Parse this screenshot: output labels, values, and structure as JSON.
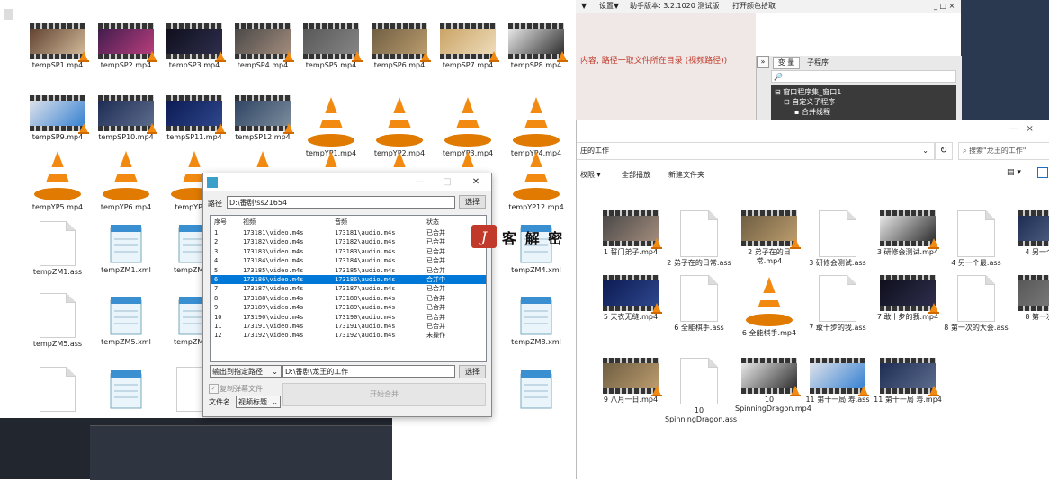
{
  "desktop": {
    "row1": [
      "tempSP1.mp4",
      "tempSP2.mp4",
      "tempSP3.mp4",
      "tempSP4.mp4",
      "tempSP5.mp4",
      "tempSP6.mp4",
      "tempSP7.mp4",
      "tempSP8.mp4"
    ],
    "row2": [
      "tempSP9.mp4",
      "tempSP10.mp4",
      "tempSP11.mp4",
      "tempSP12.mp4",
      "tempYP1.mp4",
      "tempYP2.mp4",
      "tempYP3.mp4",
      "tempYP4.mp4"
    ],
    "row3": [
      "tempYP5.mp4",
      "tempYP6.mp4",
      "tempYP7...",
      "",
      "",
      "",
      "",
      "tempYP12.mp4"
    ],
    "row4": [
      "tempZM1.ass",
      "tempZM1.xml",
      "tempZM2...",
      "",
      "",
      "",
      "",
      "tempZM4.xml"
    ],
    "row5": [
      "tempZM5.ass",
      "tempZM5.xml",
      "tempZM6...",
      "",
      "",
      "",
      "",
      "tempZM8.xml"
    ]
  },
  "topbar": {
    "settings": "设置▼",
    "helper_version": "助手版本: 3.2.1020 测试版",
    "color_picker": "打开颜色拾取"
  },
  "red_message": "内容, 路径一取文件所在目录 (视频路径))",
  "ide_panel": {
    "tab_vars": "变 量",
    "tab_subs": "子程序",
    "search_placeholder": "🔎",
    "tree": [
      "窗口程序集_窗口1",
      "自定义子程序",
      "合并线程"
    ]
  },
  "explorer": {
    "breadcrumb": "庄的工作",
    "search_placeholder": "搜索\"龙王的工作\"",
    "toolbar": [
      "权限 ▾",
      "全部播放",
      "新建文件夹"
    ],
    "files": [
      "1 誓门弟子.mp4",
      "2 弟子在的日常.ass",
      "2 弟子在的日常.mp4",
      "3 研修会测试.ass",
      "3 研修会测试.mp4",
      "4 另一个最.ass",
      "4 另一个最...",
      "5 天衣无缝.mp4",
      "6 全能棋手.ass",
      "6 全能棋手.mp4",
      "7 敢十步的我.ass",
      "7 敢十步的我.mp4",
      "8 第一次的大会.ass",
      "8 第一次的...",
      "9 八月一日.mp4",
      "10 SpinningDragon.ass",
      "10 SpinningDragon.mp4",
      "11 第十一局 寿.ass",
      "11 第十一局 寿.mp4"
    ]
  },
  "dialog": {
    "path_label": "路径",
    "path_value": "D:\\番剧\\ss21654",
    "choose1": "选择",
    "columns": [
      "序号",
      "视频",
      "音频",
      "状态"
    ],
    "rows": [
      [
        "1",
        "173181\\video.m4s",
        "173181\\audio.m4s",
        "已合并"
      ],
      [
        "2",
        "173182\\video.m4s",
        "173182\\audio.m4s",
        "已合并"
      ],
      [
        "3",
        "173183\\video.m4s",
        "173183\\audio.m4s",
        "已合并"
      ],
      [
        "4",
        "173184\\video.m4s",
        "173184\\audio.m4s",
        "已合并"
      ],
      [
        "5",
        "173185\\video.m4s",
        "173185\\audio.m4s",
        "已合并"
      ],
      [
        "6",
        "173186\\video.m4s",
        "173186\\audio.m4s",
        "合并中"
      ],
      [
        "7",
        "173187\\video.m4s",
        "173187\\audio.m4s",
        "已合并"
      ],
      [
        "8",
        "173188\\video.m4s",
        "173188\\audio.m4s",
        "已合并"
      ],
      [
        "9",
        "173189\\video.m4s",
        "173189\\audio.m4s",
        "已合并"
      ],
      [
        "10",
        "173190\\video.m4s",
        "173190\\audio.m4s",
        "已合并"
      ],
      [
        "11",
        "173191\\video.m4s",
        "173191\\audio.m4s",
        "已合并"
      ],
      [
        "12",
        "173192\\video.m4s",
        "173192\\audio.m4s",
        "未操作"
      ]
    ],
    "selected_row": 5,
    "output_select": "输出到指定路径",
    "output_value": "D:\\番剧\\龙王的工作",
    "choose2": "选择",
    "checkbox_label": "复制弹幕文件",
    "filename_label": "文件名",
    "filename_select": "视频标题",
    "start_button": "开始合并"
  },
  "watermark": "客 解 密",
  "colors": {
    "accent": "#0078d7",
    "vlc": "#f28a12",
    "red": "#c0392b"
  }
}
